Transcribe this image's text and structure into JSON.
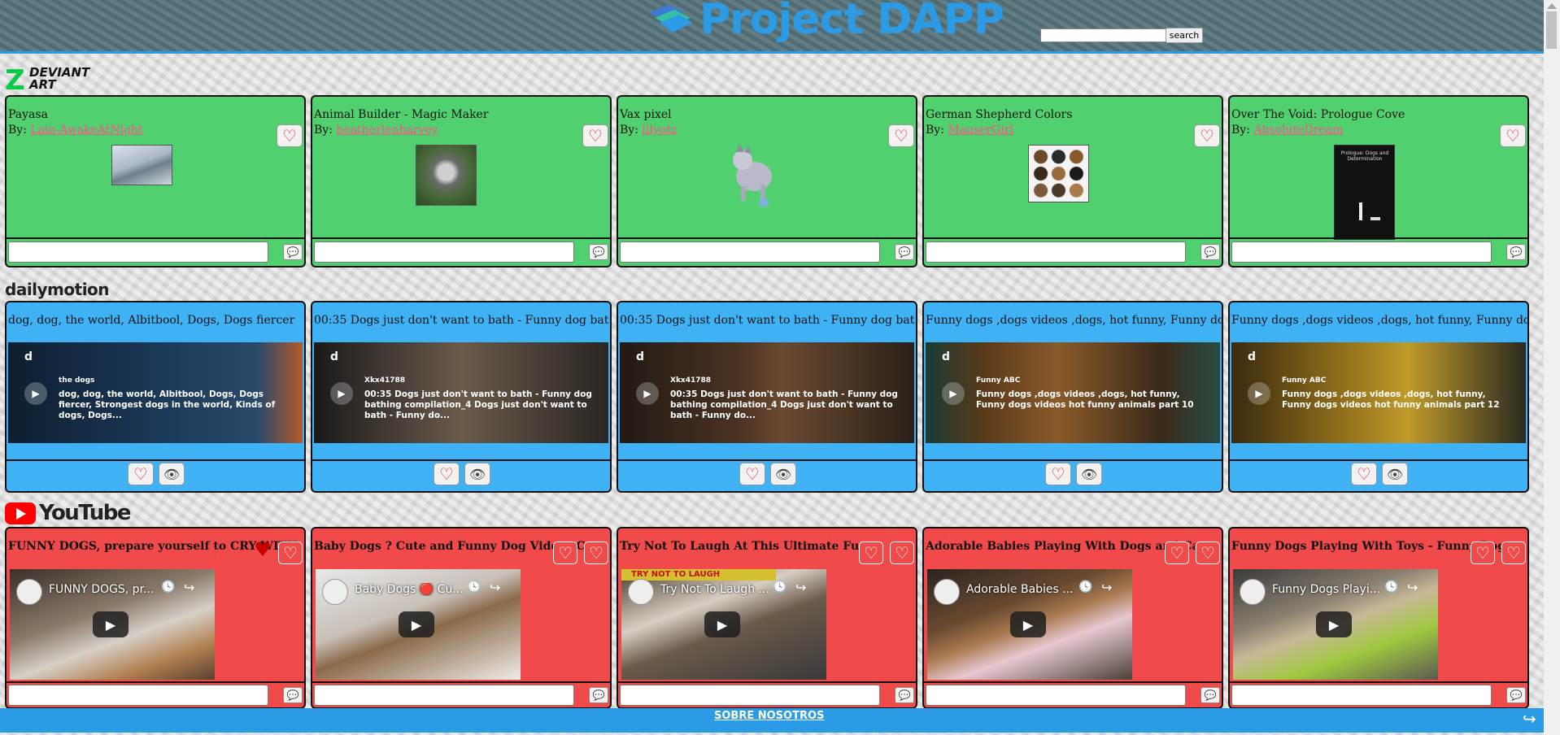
{
  "header": {
    "brand": "Project DAPP",
    "search_placeholder": "",
    "search_button": "search",
    "colors": {
      "brand": "#2b9be5",
      "bar": "#557279"
    }
  },
  "sections": {
    "deviantart": {
      "logo_text": "DEVIANT ART",
      "logo_mark": "Z"
    },
    "dailymotion": {
      "logo_text": "dailymotion"
    },
    "youtube": {
      "logo_text": "YouTube"
    }
  },
  "deviantart_cards": [
    {
      "title": "Payasa",
      "by_label": "By:",
      "author": "Lain-AwakeAtNight"
    },
    {
      "title": "Animal Builder - Magic Maker",
      "by_label": "By:",
      "author": "heatherlenharvey"
    },
    {
      "title": "Vax pixel",
      "by_label": "By:",
      "author": "lilyotz"
    },
    {
      "title": "German Shepherd Colors",
      "by_label": "By:",
      "author": "MauserGirl"
    },
    {
      "title": "Over The Void: Prologue Cove",
      "by_label": "By:",
      "author": "AbsoluteDream",
      "image_text": "Prologue: Dogs and Determination"
    }
  ],
  "dailymotion_cards": [
    {
      "title": "dog, dog, the world, Albitbool, Dogs, Dogs fiercer",
      "owner": "the dogs",
      "video_title": "dog, dog, the world, Albitbool, Dogs, Dogs fiercer, Strongest dogs in the world, Kinds of dogs, Dogs..."
    },
    {
      "title": "00:35 Dogs just don't want to bath - Funny dog bat",
      "owner": "Xkx41788",
      "video_title": "00:35 Dogs just don't want to bath - Funny dog bathing compilation_4 Dogs just don't want to bath - Funny do..."
    },
    {
      "title": "00:35 Dogs just don't want to bath - Funny dog bat",
      "owner": "Xkx41788",
      "video_title": "00:35 Dogs just don't want to bath - Funny dog bathing compilation_4 Dogs just don't want to bath - Funny do..."
    },
    {
      "title": "Funny dogs ,dogs videos ,dogs, hot funny, Funny do",
      "owner": "Funny ABC",
      "video_title": "Funny dogs ,dogs videos ,dogs, hot funny, Funny dogs videos hot funny animals part 10"
    },
    {
      "title": "Funny dogs ,dogs videos ,dogs, hot funny, Funny do",
      "owner": "Funny ABC",
      "video_title": "Funny dogs ,dogs videos ,dogs, hot funny, Funny dogs videos hot funny animals part 12"
    }
  ],
  "dailymotion_badge": "d",
  "youtube_cards": [
    {
      "title": "FUNNY DOGS, prepare yourself to CRY WITH",
      "video_title": "FUNNY DOGS, pr..."
    },
    {
      "title": "Baby Dogs ? Cute and Funny Dog Videos C",
      "video_title": "Baby Dogs 🔴 Cu..."
    },
    {
      "title": "Try Not To Laugh At This Ultimate Funny",
      "video_title": "Try Not To Laugh ...",
      "overlay_text": "TRY NOT TO LAUGH"
    },
    {
      "title": "Adorable Babies Playing With Dogs and Ca",
      "video_title": "Adorable Babies ..."
    },
    {
      "title": "Funny Dogs Playing With Toys - Funny Dog",
      "video_title": "Funny Dogs Playi..."
    }
  ],
  "icons": {
    "heart": "♡",
    "heart_filled": "♥",
    "eye": "👁",
    "comment": "💬",
    "play": "▶",
    "clock": "🕓",
    "share": "↪"
  },
  "footer": {
    "link": "SOBRE NOSOTROS",
    "color": "#2b9be5"
  }
}
